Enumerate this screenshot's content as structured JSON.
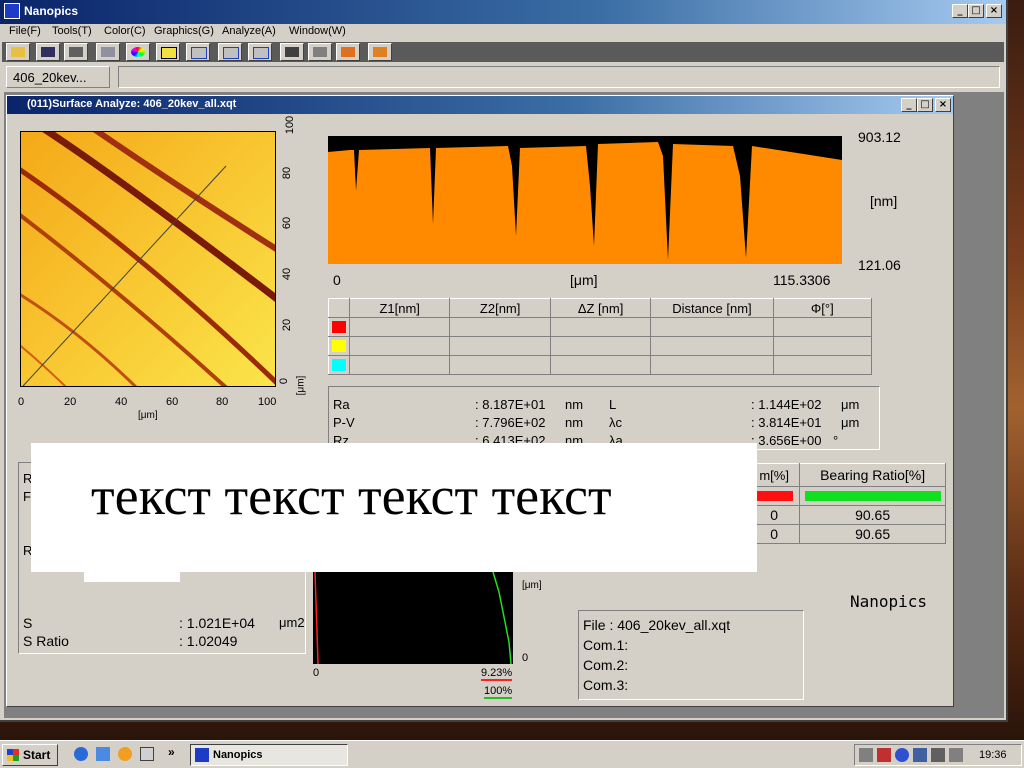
{
  "app": {
    "title": "Nanopics"
  },
  "window_buttons": [
    "_",
    "□",
    "×"
  ],
  "menu": [
    "File(F)",
    "Tools(T)",
    "Color(C)",
    "Graphics(G)",
    "Analyze(A)",
    "Window(W)"
  ],
  "tab": {
    "label": "406_20kev..."
  },
  "child": {
    "title": "(011)Surface Analyze: 406_20kev_all.xqt"
  },
  "map": {
    "x_ticks": [
      "0",
      "20",
      "40",
      "60",
      "80",
      "100"
    ],
    "y_ticks": [
      "0",
      "20",
      "40",
      "60",
      "80",
      "100"
    ],
    "x_unit": "[μm]",
    "y_unit": "[μm]"
  },
  "profile": {
    "z_max": "903.12",
    "z_min": "121.06",
    "z_unit": "[nm]",
    "x_min": "0",
    "x_unit": "[μm]",
    "x_max": "115.3306"
  },
  "cursor_table": {
    "headers": [
      "Z1[nm]",
      "Z2[nm]",
      "ΔZ [nm]",
      "Distance [nm]",
      "Φ[°]"
    ],
    "row_colors": [
      "#ff0000",
      "#ffff00",
      "#00ffff"
    ]
  },
  "stats": {
    "left": [
      {
        "label": "Ra",
        "value": ": 8.187E+01",
        "unit": "nm"
      },
      {
        "label": "P-V",
        "value": ": 7.796E+02",
        "unit": "nm"
      },
      {
        "label": "Rz",
        "value": ": 6.413E+02",
        "unit": "nm"
      }
    ],
    "right": [
      {
        "label": "L",
        "value": ": 1.144E+02",
        "unit": "μm"
      },
      {
        "label": "λc",
        "value": ": 3.814E+01",
        "unit": "μm"
      },
      {
        "label": "λa",
        "value": ": 3.656E+00",
        "unit": "°"
      }
    ]
  },
  "overlay_text": "текст текст текст текст",
  "bearing": {
    "header_partial": "m[%]",
    "header": "Bearing Ratio[%]",
    "row1_left": "0",
    "row1_right": "90.65",
    "row2_left": "0",
    "row2_right": "90.65"
  },
  "left_panel": {
    "labels_top": [
      "R",
      "F",
      "R"
    ],
    "s_label": "S",
    "s_value": ": 1.021E+04",
    "s_unit": "μm2",
    "sratio_label": "S Ratio",
    "sratio_value": ": 1.02049"
  },
  "histogram": {
    "unit": "[μm]",
    "x0": "0",
    "y0": "0",
    "pct1": "9.23%",
    "pct2": "100%"
  },
  "brand": "Nanopics",
  "fileinfo": {
    "file": "File     : 406_20kev_all.xqt",
    "com1": "Com.1:",
    "com2": "Com.2:",
    "com3": "Com.3:"
  },
  "taskbar": {
    "start": "Start",
    "chevron": "»",
    "task": "Nanopics",
    "time": "19:36"
  }
}
